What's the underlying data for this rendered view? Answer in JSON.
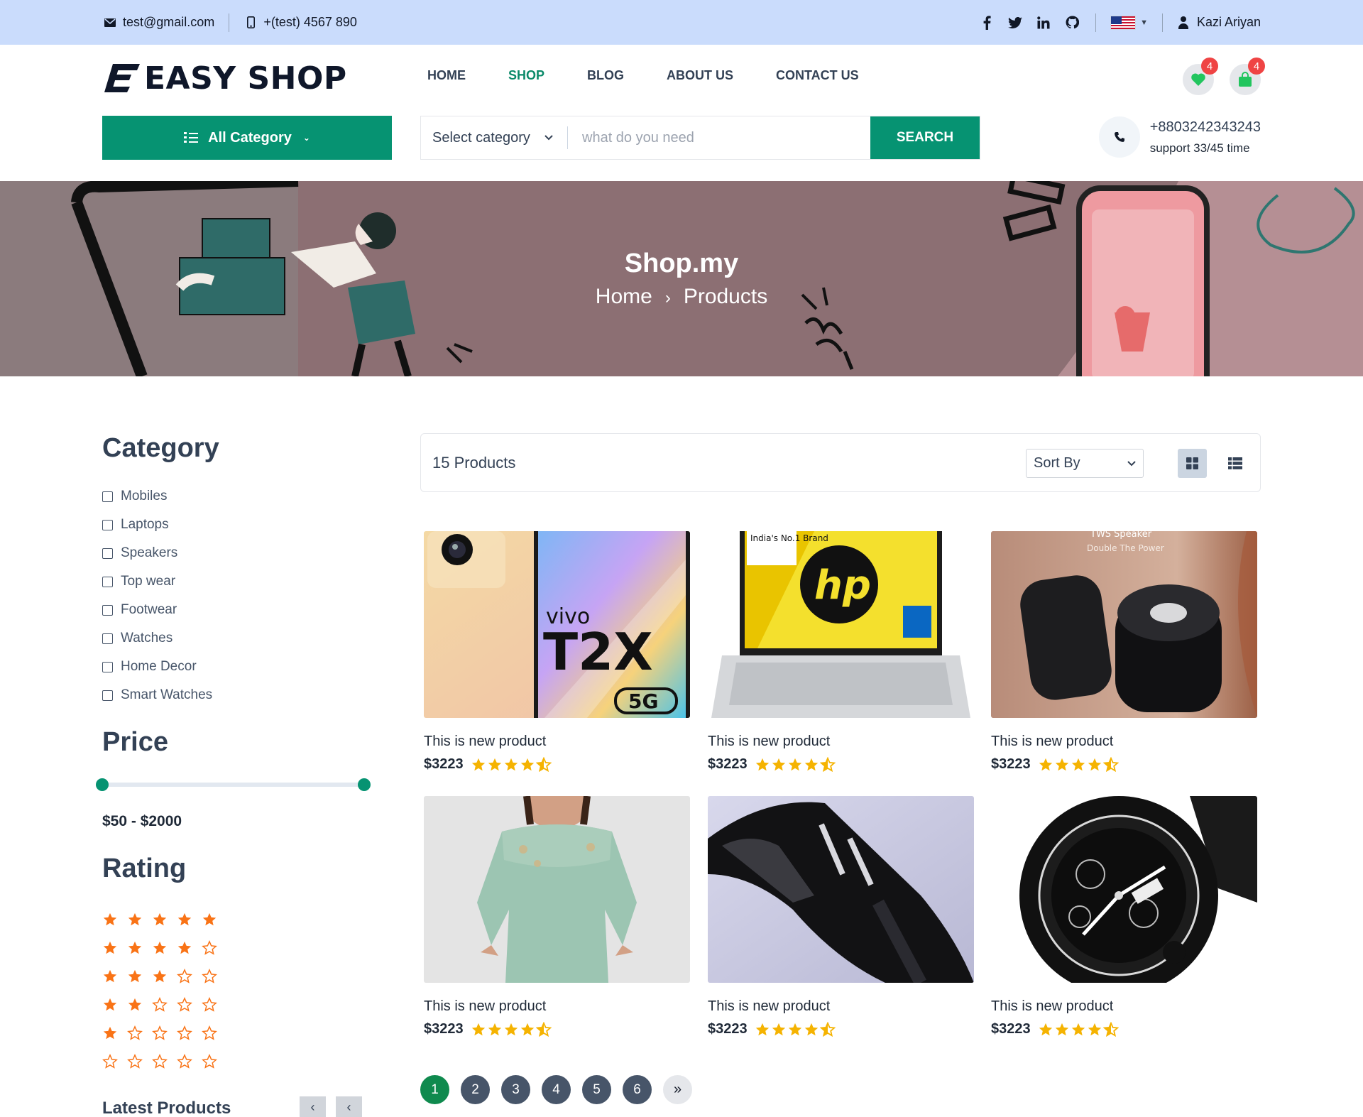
{
  "topbar": {
    "email": "test@gmail.com",
    "phone": "+(test) 4567 890",
    "social": [
      "facebook-icon",
      "twitter-icon",
      "linkedin-icon",
      "github-icon"
    ],
    "language_flag": "us-flag-icon",
    "user_name": "Kazi Ariyan"
  },
  "header": {
    "logo_text": "EASY SHOP",
    "nav": [
      "HOME",
      "SHOP",
      "BLOG",
      "ABOUT US",
      "CONTACT US"
    ],
    "active_nav": "SHOP",
    "wishlist_count": "4",
    "cart_count": "4",
    "all_category_label": "All Category",
    "search": {
      "category_select": "Select category",
      "placeholder": "what do you need",
      "button_label": "SEARCH"
    },
    "support": {
      "phone": "+8803242343243",
      "time": "support 33/45 time"
    }
  },
  "banner": {
    "title": "Shop.my",
    "breadcrumb": [
      "Home",
      "Products"
    ]
  },
  "sidebar": {
    "category_heading": "Category",
    "categories": [
      "Mobiles",
      "Laptops",
      "Speakers",
      "Top wear",
      "Footwear",
      "Watches",
      "Home Decor",
      "Smart Watches"
    ],
    "price_heading": "Price",
    "price_range": "$50 - $2000",
    "price_min": 50,
    "price_max": 2000,
    "rating_heading": "Rating",
    "rating_rows": [
      5,
      4,
      3,
      2,
      1,
      0
    ],
    "latest_heading": "Latest Products"
  },
  "products_area": {
    "count_label": "15 Products",
    "sort_label": "Sort By",
    "products": [
      {
        "name": "This is new product",
        "price": "$3223",
        "rating": 4.5
      },
      {
        "name": "This is new product",
        "price": "$3223",
        "rating": 4.5
      },
      {
        "name": "This is new product",
        "price": "$3223",
        "rating": 4.5
      },
      {
        "name": "This is new product",
        "price": "$3223",
        "rating": 4.5
      },
      {
        "name": "This is new product",
        "price": "$3223",
        "rating": 4.5
      },
      {
        "name": "This is new product",
        "price": "$3223",
        "rating": 4.5
      }
    ],
    "image_texts": {
      "phone_brand": "vivo",
      "phone_model": "T2X",
      "phone_5g": "5G",
      "laptop_badge": "India's No.1 Brand",
      "laptop_logo": "hp",
      "speaker_title": "TWS Speaker",
      "speaker_sub": "Double The Power"
    },
    "pagination": [
      "1",
      "2",
      "3",
      "4",
      "5",
      "6",
      "»"
    ],
    "current_page": "1"
  },
  "colors": {
    "brand_green": "#069372",
    "topbar_bg": "#cadcfc",
    "star_gold": "#f5b301",
    "rating_orange": "#f97316",
    "badge_red": "#ef4444"
  }
}
